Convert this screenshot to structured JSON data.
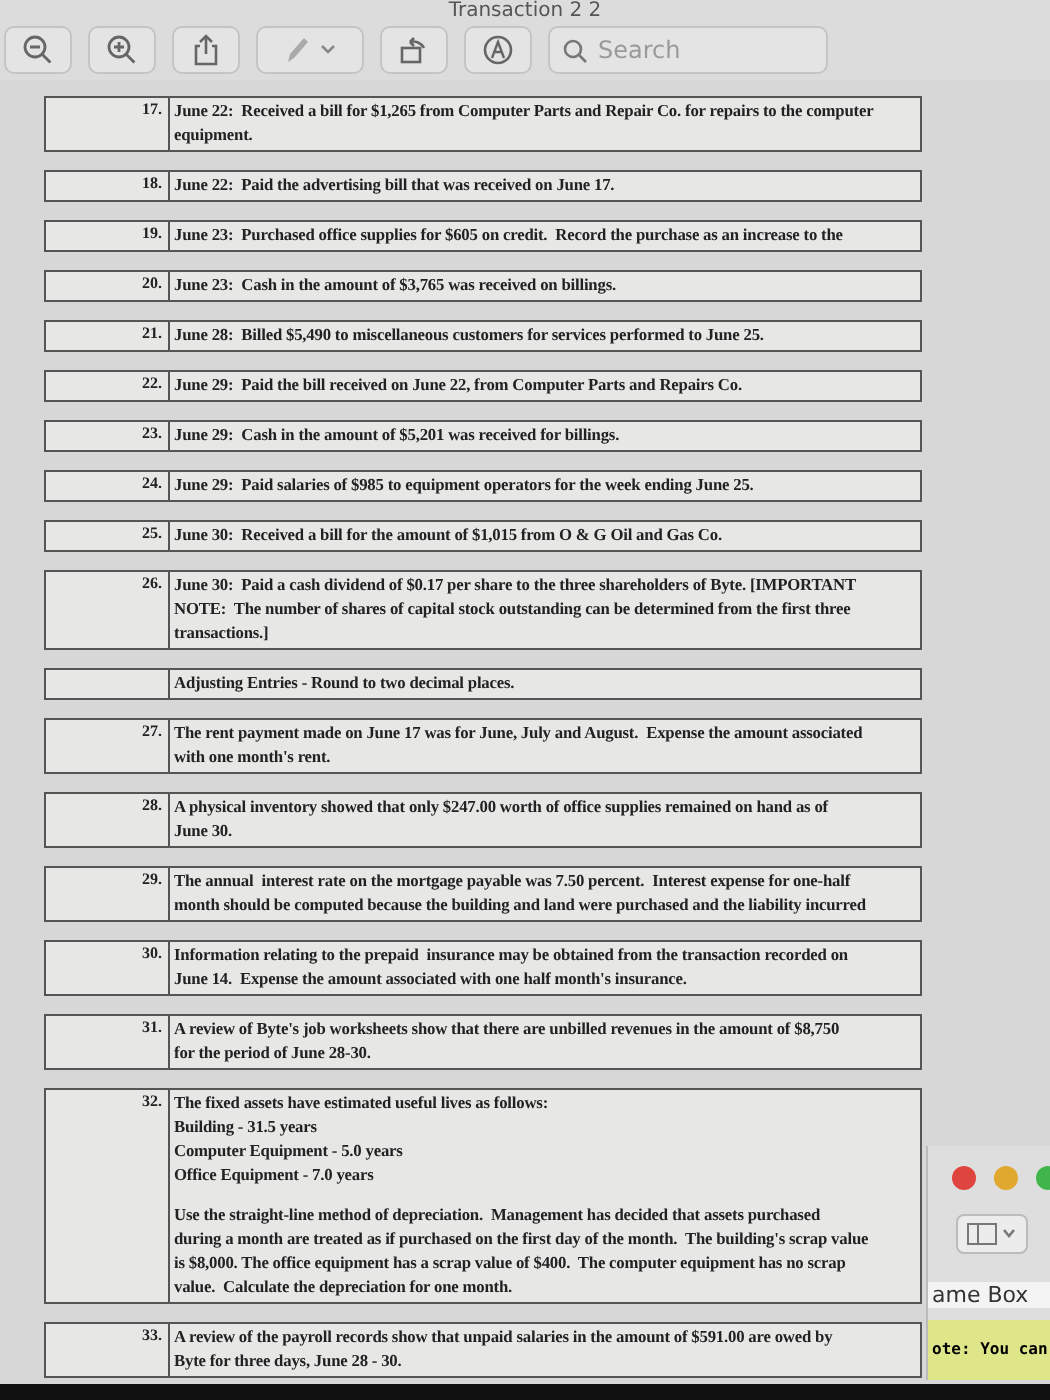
{
  "window": {
    "title": "Transaction 2 2"
  },
  "toolbar": {
    "search": {
      "placeholder": "Search"
    }
  },
  "rows": [
    {
      "kind": "entry",
      "number": "17.",
      "paragraphs": [
        [
          "June 22:  Received a bill for $1,265 from Computer Parts and Repair Co. for repairs to the computer",
          "equipment."
        ]
      ]
    },
    {
      "kind": "entry",
      "number": "18.",
      "paragraphs": [
        [
          "June 22:  Paid the advertising bill that was received on June 17."
        ]
      ]
    },
    {
      "kind": "entry",
      "number": "19.",
      "paragraphs": [
        [
          "June 23:  Purchased office supplies for $605 on credit.  Record the purchase as an increase to the"
        ]
      ]
    },
    {
      "kind": "entry",
      "number": "20.",
      "paragraphs": [
        [
          "June 23:  Cash in the amount of $3,765 was received on billings."
        ]
      ]
    },
    {
      "kind": "entry",
      "number": "21.",
      "paragraphs": [
        [
          "June 28:  Billed $5,490 to miscellaneous customers for services performed to June 25."
        ]
      ]
    },
    {
      "kind": "entry",
      "number": "22.",
      "paragraphs": [
        [
          "June 29:  Paid the bill received on June 22, from Computer Parts and Repairs Co."
        ]
      ]
    },
    {
      "kind": "entry",
      "number": "23.",
      "paragraphs": [
        [
          "June 29:  Cash in the amount of $5,201 was received for billings."
        ]
      ]
    },
    {
      "kind": "entry",
      "number": "24.",
      "paragraphs": [
        [
          "June 29:  Paid salaries of $985 to equipment operators for the week ending June 25."
        ]
      ]
    },
    {
      "kind": "entry",
      "number": "25.",
      "paragraphs": [
        [
          "June 30:  Received a bill for the amount of $1,015 from O & G Oil and Gas Co."
        ]
      ]
    },
    {
      "kind": "entry",
      "number": "26.",
      "paragraphs": [
        [
          "June 30:  Paid a cash dividend of $0.17 per share to the three shareholders of Byte. [IMPORTANT",
          "NOTE:  The number of shares of capital stock outstanding can be determined from the first three",
          "transactions.]"
        ]
      ]
    },
    {
      "kind": "heading",
      "paragraphs": [
        [
          "Adjusting Entries - Round to two decimal places."
        ]
      ]
    },
    {
      "kind": "entry",
      "number": "27.",
      "paragraphs": [
        [
          "The rent payment made on June 17 was for June, July and August.  Expense the amount associated",
          "with one month's rent."
        ]
      ]
    },
    {
      "kind": "entry",
      "number": "28.",
      "paragraphs": [
        [
          "A physical inventory showed that only $247.00 worth of office supplies remained on hand as of",
          "June 30."
        ]
      ]
    },
    {
      "kind": "entry",
      "number": "29.",
      "paragraphs": [
        [
          "The annual  interest rate on the mortgage payable was 7.50 percent.  Interest expense for one-half",
          "month should be computed because the building and land were purchased and the liability incurred"
        ]
      ]
    },
    {
      "kind": "entry",
      "number": "30.",
      "paragraphs": [
        [
          "Information relating to the prepaid  insurance may be obtained from the transaction recorded on",
          "June 14.  Expense the amount associated with one half month's insurance."
        ]
      ]
    },
    {
      "kind": "entry",
      "number": "31.",
      "paragraphs": [
        [
          "A review of Byte's job worksheets show that there are unbilled revenues in the amount of $8,750",
          "for the period of June 28-30."
        ]
      ]
    },
    {
      "kind": "entry",
      "number": "32.",
      "paragraphs": [
        [
          "The fixed assets have estimated useful lives as follows:"
        ],
        [
          "Building - 31.5 years"
        ],
        [
          "Computer Equipment - 5.0 years"
        ],
        [
          "Office Equipment - 7.0 years"
        ],
        [
          "Use the straight-line method of depreciation.  Management has decided that assets purchased",
          "during a month are treated as if purchased on the first day of the month.  The building's scrap value",
          "is $8,000. The office equipment has a scrap value of $400.  The computer equipment has no scrap",
          "value.  Calculate the depreciation for one month."
        ]
      ]
    },
    {
      "kind": "entry",
      "number": "33.",
      "paragraphs": [
        [
          "A review of the payroll records show that unpaid salaries in the amount of $591.00 are owed by",
          "Byte for three days, June 28 - 30."
        ]
      ]
    }
  ],
  "overlay": {
    "name_box": "ame Box",
    "note": "ote: You can"
  }
}
